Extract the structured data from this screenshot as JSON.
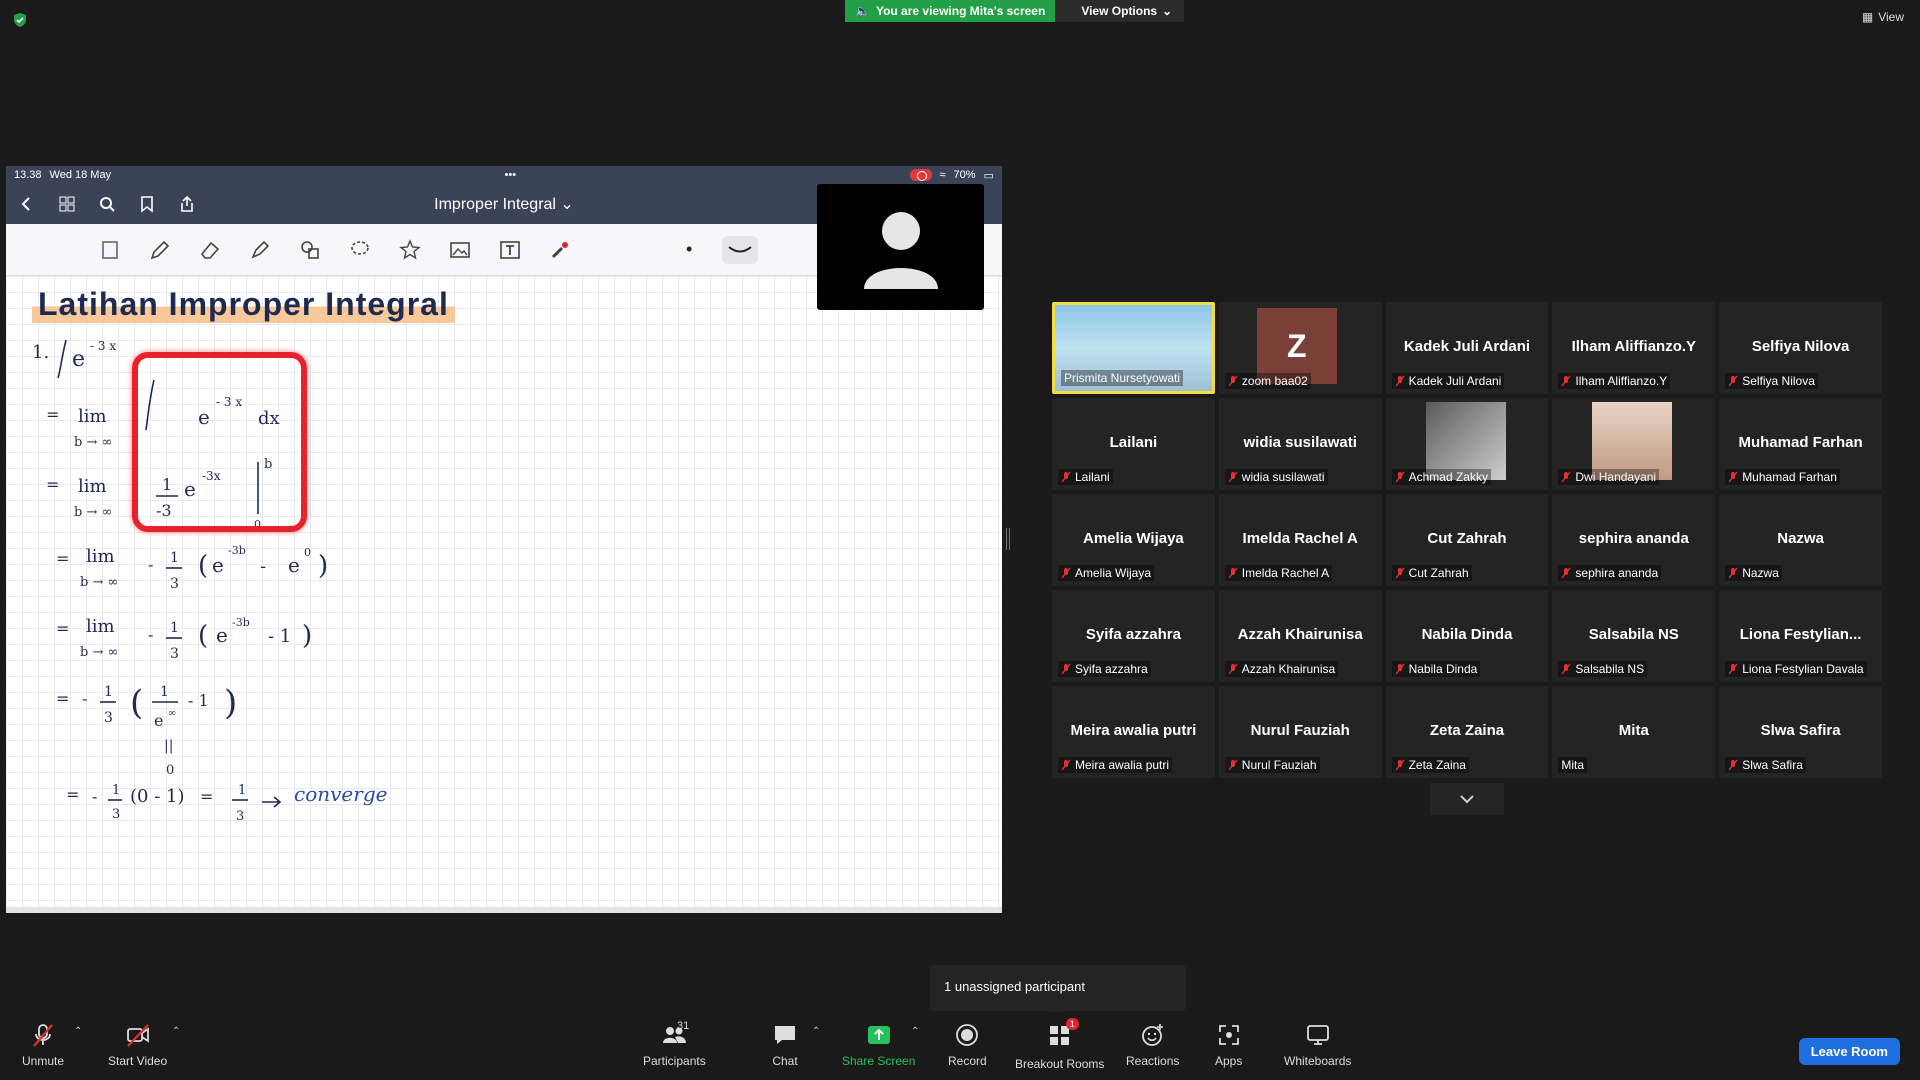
{
  "top": {
    "viewing_banner": "You are viewing Mita's screen",
    "view_options": "View Options",
    "view_label": "View"
  },
  "shared": {
    "status_time": "13.38",
    "status_date": "Wed 18 May",
    "status_battery": "70%",
    "doc_title": "Improper Integral",
    "hw_title": "Latihan Improper Integral",
    "converge_word": "converge"
  },
  "gallery": {
    "rows": [
      [
        {
          "big": "",
          "small": "Prismita Nursetyowati",
          "muted": false,
          "kind": "photo-prism",
          "active": true
        },
        {
          "big": "",
          "small": "zoom baa02",
          "muted": true,
          "kind": "avatar-z",
          "letter": "Z"
        },
        {
          "big": "Kadek Juli Ardani",
          "small": "Kadek Juli Ardani",
          "muted": true
        },
        {
          "big": "Ilham Aliffianzo.Y",
          "small": "Ilham Aliffianzo.Y",
          "muted": true
        },
        {
          "big": "Selfiya Nilova",
          "small": "Selfiya Nilova",
          "muted": true
        }
      ],
      [
        {
          "big": "Lailani",
          "small": "Lailani",
          "muted": true
        },
        {
          "big": "widia susilawati",
          "small": "widia susilawati",
          "muted": true
        },
        {
          "big": "",
          "small": "Achmad Zakky",
          "muted": true,
          "kind": "photo-az"
        },
        {
          "big": "",
          "small": "Dwi Handayani",
          "muted": true,
          "kind": "photo-dwi"
        },
        {
          "big": "Muhamad Farhan",
          "small": "Muhamad Farhan",
          "muted": true
        }
      ],
      [
        {
          "big": "Amelia Wijaya",
          "small": "Amelia Wijaya",
          "muted": true
        },
        {
          "big": "Imelda Rachel A",
          "small": "Imelda Rachel A",
          "muted": true
        },
        {
          "big": "Cut Zahrah",
          "small": "Cut Zahrah",
          "muted": true
        },
        {
          "big": "sephira ananda",
          "small": "sephira ananda",
          "muted": true
        },
        {
          "big": "Nazwa",
          "small": "Nazwa",
          "muted": true
        }
      ],
      [
        {
          "big": "Syifa azzahra",
          "small": "Syifa azzahra",
          "muted": true
        },
        {
          "big": "Azzah Khairunisa",
          "small": "Azzah Khairunisa",
          "muted": true
        },
        {
          "big": "Nabila Dinda",
          "small": "Nabila Dinda",
          "muted": true
        },
        {
          "big": "Salsabila NS",
          "small": "Salsabila NS",
          "muted": true
        },
        {
          "big": "Liona Festylian...",
          "small": "Liona Festylian Davala",
          "muted": true
        }
      ],
      [
        {
          "big": "Meira awalia putri",
          "small": "Meira awalia putri",
          "muted": true
        },
        {
          "big": "Nurul Fauziah",
          "small": "Nurul Fauziah",
          "muted": true
        },
        {
          "big": "Zeta Zaina",
          "small": "Zeta Zaina",
          "muted": true
        },
        {
          "big": "Mita",
          "small": "Mita",
          "muted": false
        },
        {
          "big": "Slwa Safira",
          "small": "Slwa Safira",
          "muted": true
        }
      ]
    ]
  },
  "tooltip": "1 unassigned participant",
  "toolbar": {
    "unmute": "Unmute",
    "start_video": "Start Video",
    "participants": "Participants",
    "participants_count": "31",
    "chat": "Chat",
    "share_screen": "Share Screen",
    "record": "Record",
    "breakout_rooms": "Breakout Rooms",
    "breakout_badge": "1",
    "reactions": "Reactions",
    "apps": "Apps",
    "whiteboards": "Whiteboards",
    "leave": "Leave Room"
  }
}
